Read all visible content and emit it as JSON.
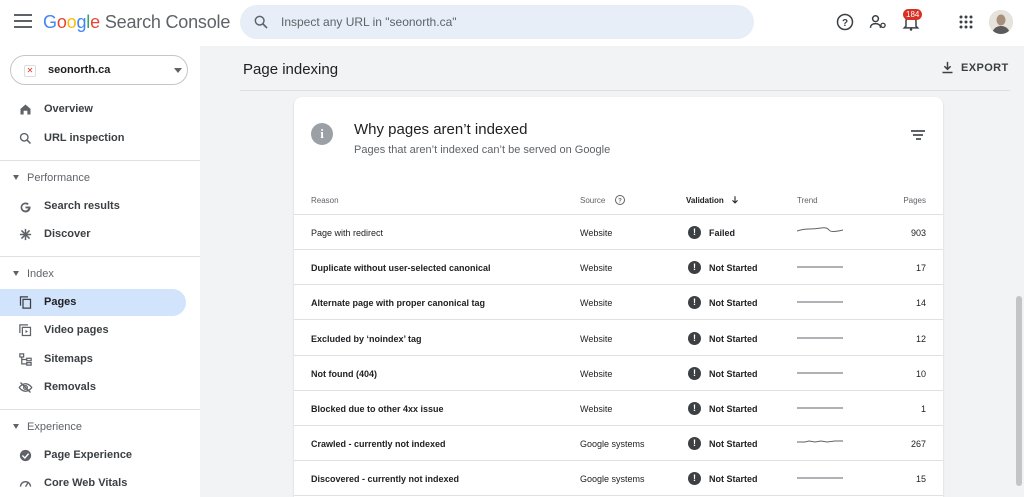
{
  "header": {
    "logo_letters": [
      "G",
      "o",
      "o",
      "g",
      "l",
      "e"
    ],
    "product": "Search Console",
    "search_placeholder": "Inspect any URL in \"seonorth.ca\"",
    "notifications_count": "184"
  },
  "sidebar": {
    "property": "seonorth.ca",
    "top_items": [
      {
        "label": "Overview",
        "icon": "home-icon"
      },
      {
        "label": "URL inspection",
        "icon": "search-icon"
      }
    ],
    "sections": [
      {
        "label": "Performance",
        "items": [
          {
            "label": "Search results",
            "icon": "google-g-icon"
          },
          {
            "label": "Discover",
            "icon": "asterisk-icon"
          }
        ]
      },
      {
        "label": "Index",
        "items": [
          {
            "label": "Pages",
            "icon": "pages-icon",
            "active": true
          },
          {
            "label": "Video pages",
            "icon": "video-pages-icon"
          },
          {
            "label": "Sitemaps",
            "icon": "sitemaps-icon"
          },
          {
            "label": "Removals",
            "icon": "removals-icon"
          }
        ]
      },
      {
        "label": "Experience",
        "items": [
          {
            "label": "Page Experience",
            "icon": "page-experience-icon"
          },
          {
            "label": "Core Web Vitals",
            "icon": "speedometer-icon"
          }
        ]
      }
    ]
  },
  "main": {
    "page_title": "Page indexing",
    "export_label": "EXPORT",
    "card": {
      "title": "Why pages aren’t indexed",
      "subtitle": "Pages that aren’t indexed can’t be served on Google",
      "columns": {
        "reason": "Reason",
        "source": "Source",
        "validation": "Validation",
        "trend": "Trend",
        "pages": "Pages"
      },
      "rows": [
        {
          "reason": "Page with redirect",
          "source": "Website",
          "validation": "Failed",
          "pages": "903",
          "trend": "wave"
        },
        {
          "reason": "Duplicate without user-selected canonical",
          "source": "Website",
          "validation": "Not Started",
          "pages": "17",
          "trend": "flat"
        },
        {
          "reason": "Alternate page with proper canonical tag",
          "source": "Website",
          "validation": "Not Started",
          "pages": "14",
          "trend": "flat"
        },
        {
          "reason": "Excluded by ‘noindex’ tag",
          "source": "Website",
          "validation": "Not Started",
          "pages": "12",
          "trend": "flat"
        },
        {
          "reason": "Not found (404)",
          "source": "Website",
          "validation": "Not Started",
          "pages": "10",
          "trend": "flat"
        },
        {
          "reason": "Blocked due to other 4xx issue",
          "source": "Website",
          "validation": "Not Started",
          "pages": "1",
          "trend": "flat"
        },
        {
          "reason": "Crawled - currently not indexed",
          "source": "Google systems",
          "validation": "Not Started",
          "pages": "267",
          "trend": "bumpy"
        },
        {
          "reason": "Discovered - currently not indexed",
          "source": "Google systems",
          "validation": "Not Started",
          "pages": "15",
          "trend": "flat"
        }
      ]
    }
  },
  "colors": {
    "accent": "#1a73e8",
    "active_nav_bg": "#d2e3fc",
    "badge": "#d93025"
  }
}
